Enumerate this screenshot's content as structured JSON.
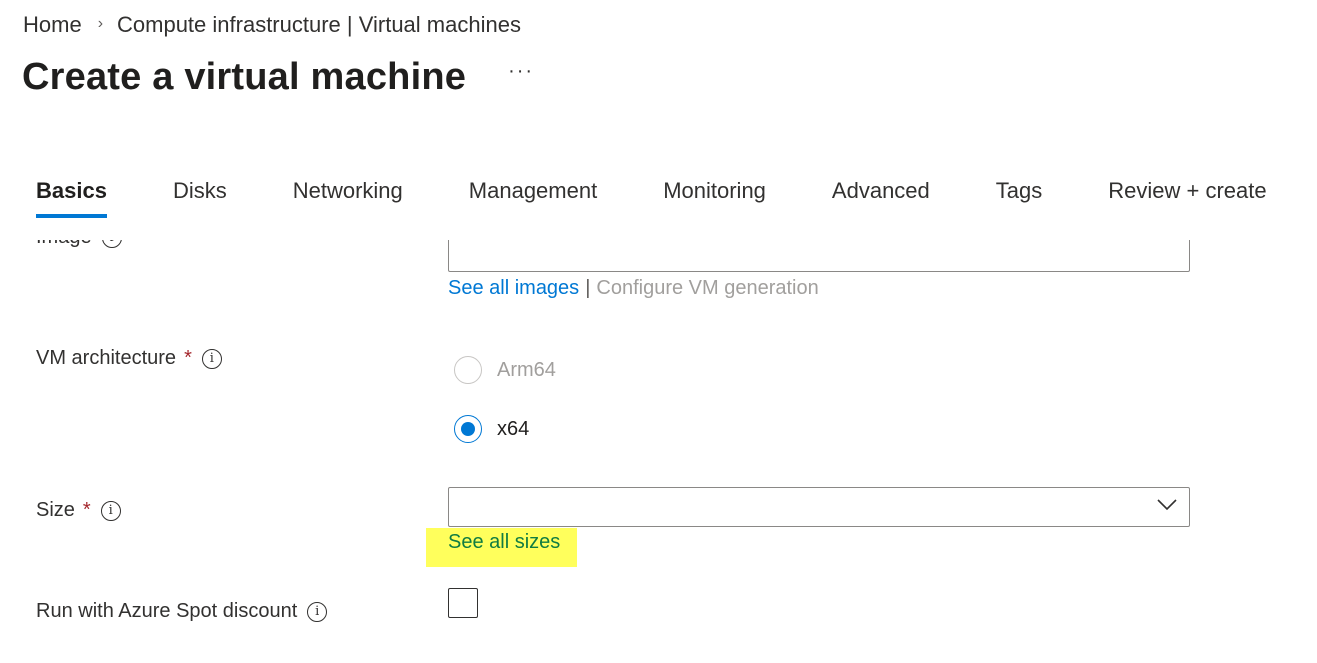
{
  "breadcrumb": {
    "items": [
      "Home",
      "Compute infrastructure | Virtual machines"
    ],
    "separator": "›"
  },
  "header": {
    "title": "Create a virtual machine",
    "more_label": "···"
  },
  "tabs": [
    {
      "label": "Basics",
      "active": true
    },
    {
      "label": "Disks",
      "active": false
    },
    {
      "label": "Networking",
      "active": false
    },
    {
      "label": "Management",
      "active": false
    },
    {
      "label": "Monitoring",
      "active": false
    },
    {
      "label": "Advanced",
      "active": false
    },
    {
      "label": "Tags",
      "active": false
    },
    {
      "label": "Review + create",
      "active": false
    }
  ],
  "form": {
    "image": {
      "label": "Image",
      "links": {
        "see_all_images": "See all images",
        "separator": "|",
        "configure_vm_generation": "Configure VM generation"
      }
    },
    "vm_architecture": {
      "label": "VM architecture",
      "required_mark": "*",
      "info_icon": "i",
      "options": [
        {
          "label": "Arm64",
          "checked": false,
          "disabled": true
        },
        {
          "label": "x64",
          "checked": true,
          "disabled": false
        }
      ]
    },
    "size": {
      "label": "Size",
      "required_mark": "*",
      "info_icon": "i",
      "value": "",
      "see_all_sizes": "See all sizes"
    },
    "spot_discount": {
      "label": "Run with Azure Spot discount",
      "info_icon": "i",
      "checked": false
    }
  },
  "colors": {
    "accent": "#0078d4",
    "required": "#a4262c",
    "highlight": "#ffff5c",
    "disabled_text": "#a19f9d"
  }
}
